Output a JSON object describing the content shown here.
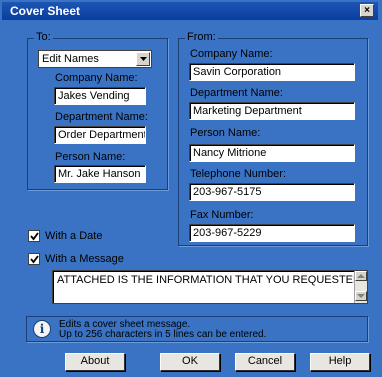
{
  "window": {
    "title": "Cover Sheet",
    "close_glyph": "×"
  },
  "to_group": {
    "label": "To:",
    "select_value": "Edit Names",
    "company_label": "Company Name:",
    "company_value": "Jakes Vending",
    "department_label": "Department Name:",
    "department_value": "Order Department",
    "person_label": "Person Name:",
    "person_value": "Mr. Jake Hanson"
  },
  "from_group": {
    "label": "From:",
    "company_label": "Company Name:",
    "company_value": "Savin Corporation",
    "department_label": "Department Name:",
    "department_value": "Marketing Department",
    "person_label": "Person Name:",
    "person_value": "Nancy Mitrione",
    "telephone_label": "Telephone Number:",
    "telephone_value": "203-967-5175",
    "fax_label": "Fax Number:",
    "fax_value": "203-967-5229"
  },
  "options": {
    "with_date_label": "With a Date",
    "with_date_checked": true,
    "with_message_label": "With a Message",
    "with_message_checked": true,
    "message_text": "ATTACHED IS THE INFORMATION THAT YOU REQUESTED."
  },
  "info": {
    "icon": "info-icon",
    "line1": "Edits a cover sheet message.",
    "line2": "Up to 256 characters in 5 lines can be entered."
  },
  "buttons": {
    "about": "About",
    "ok": "OK",
    "cancel": "Cancel",
    "help": "Help"
  },
  "colors": {
    "background": "#3a73c4",
    "titlebar": "#0b3d9e"
  }
}
